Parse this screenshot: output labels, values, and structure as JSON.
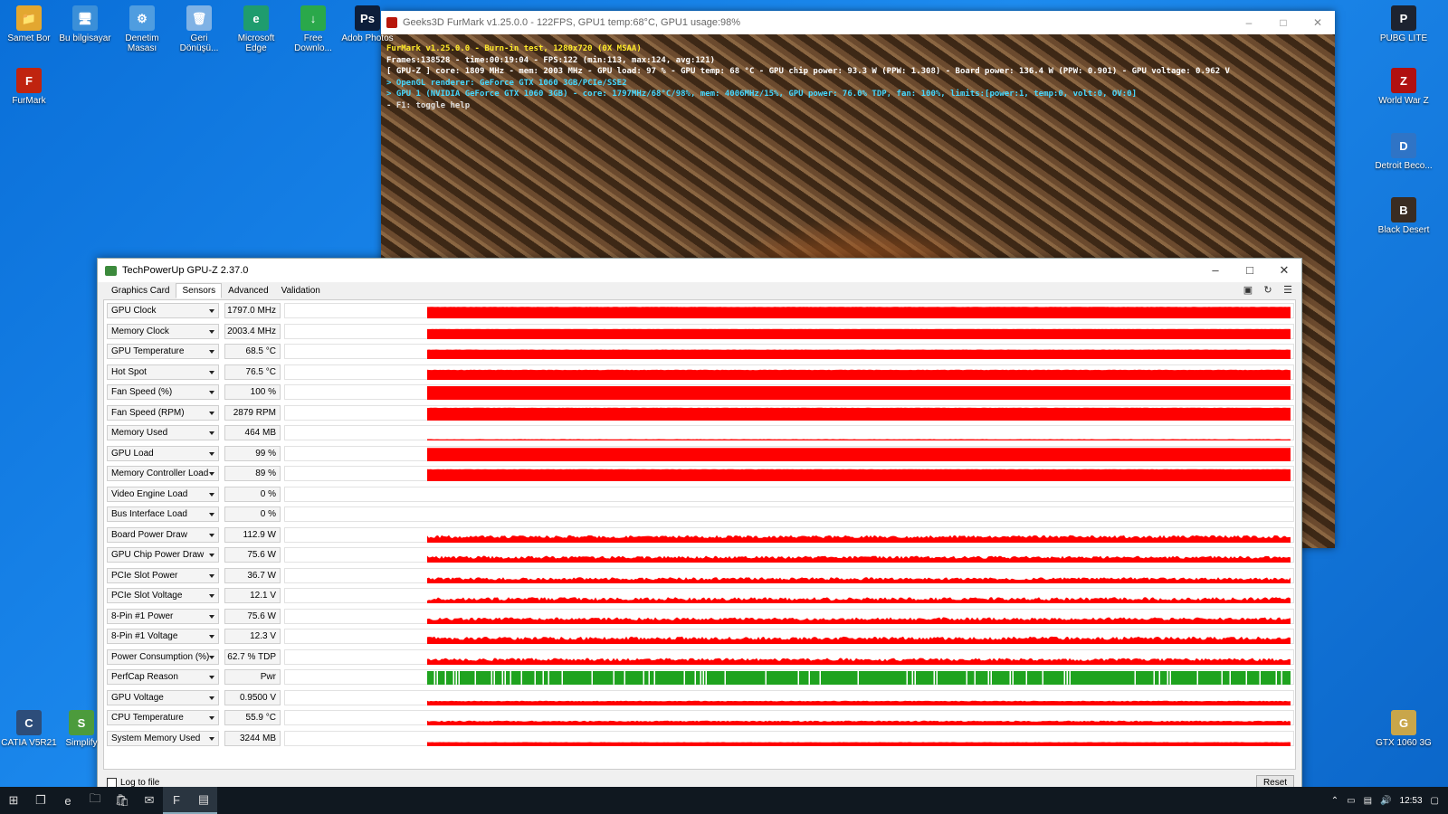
{
  "desktop": {
    "left_icons": [
      {
        "label": "Samet Bor",
        "glyph": "📁",
        "color": "#e3a730"
      },
      {
        "label": "Bu bilgisayar",
        "glyph": "🖥",
        "color": "#3b8fd8"
      },
      {
        "label": "Denetim Masası",
        "glyph": "⚙",
        "color": "#4f9de0"
      },
      {
        "label": "Geri Dönüşü...",
        "glyph": "🗑",
        "color": "#7fb2e5"
      },
      {
        "label": "Microsoft Edge",
        "glyph": "e",
        "color": "#1f9c6e"
      },
      {
        "label": "Free Downlo...",
        "glyph": "↓",
        "color": "#2aa84a"
      },
      {
        "label": "Adob Photos",
        "glyph": "Ps",
        "color": "#0d1e3a"
      }
    ],
    "furmark_icon": {
      "label": "FurMark",
      "glyph": "F",
      "color": "#c0240f"
    },
    "bottom_left_icons": [
      {
        "label": "CATIA V5R21",
        "glyph": "C",
        "color": "#2d4d7a"
      },
      {
        "label": "Simplify",
        "glyph": "S",
        "color": "#4c9b3c"
      }
    ],
    "right_icons": [
      {
        "label": "PUBG LITE",
        "glyph": "P",
        "color": "#1d2330"
      },
      {
        "label": "World War Z",
        "glyph": "Z",
        "color": "#b01010"
      },
      {
        "label": "Detroit Beco...",
        "glyph": "D",
        "color": "#2f74c6"
      },
      {
        "label": "Black Desert",
        "glyph": "B",
        "color": "#3a2c22"
      },
      {
        "label": "GTX 1060 3G",
        "glyph": "G",
        "color": "#c9a64a"
      }
    ]
  },
  "furmark": {
    "title": "Geeks3D FurMark v1.25.0.0 - 122FPS, GPU1 temp:68°C, GPU1 usage:98%",
    "overlay": [
      {
        "text": "FurMark v1.25.0.0 - Burn-in test, 1280x720 (0X MSAA)",
        "cls": "fm-y"
      },
      {
        "text": "Frames:138528 - time:00:19:04 - FPS:122 (min:113, max:124, avg:121)",
        "cls": "fm-w"
      },
      {
        "text": "[ GPU-Z ] core: 1809 MHz - mem: 2003 MHz - GPU load: 97 % - GPU temp: 68 °C - GPU chip power: 93.3 W (PPW: 1.308) - Board power: 136.4 W (PPW: 0.901) - GPU voltage: 0.962 V",
        "cls": "fm-w"
      },
      {
        "text": "> OpenGL renderer: GeForce GTX 1060 3GB/PCIe/SSE2",
        "cls": "fm-c"
      },
      {
        "text": "> GPU 1 (NVIDIA GeForce GTX 1060 3GB) - core: 1797MHz/68°C/98%, mem: 4006MHz/15%, GPU power: 76.0% TDP, fan: 100%, limits:[power:1, temp:0, volt:0, OV:0]",
        "cls": "fm-c"
      },
      {
        "text": "- F1: toggle help",
        "cls": "fm-g"
      }
    ]
  },
  "gpuz": {
    "title": "TechPowerUp GPU-Z 2.37.0",
    "tabs": [
      "Graphics Card",
      "Sensors",
      "Advanced",
      "Validation"
    ],
    "active_tab": "Sensors",
    "graph_color": "#ff0000",
    "perfcap_color": "#1fa31f",
    "sensors": [
      {
        "name": "GPU Clock",
        "value": "1797.0 MHz",
        "level": 0.85,
        "noise": 0.02
      },
      {
        "name": "Memory Clock",
        "value": "2003.4 MHz",
        "level": 0.75,
        "noise": 0.01
      },
      {
        "name": "GPU Temperature",
        "value": "68.5 °C",
        "level": 0.7,
        "noise": 0.02
      },
      {
        "name": "Hot Spot",
        "value": "76.5 °C",
        "level": 0.75,
        "noise": 0.03
      },
      {
        "name": "Fan Speed (%)",
        "value": "100 %",
        "level": 1.0,
        "noise": 0.0
      },
      {
        "name": "Fan Speed (RPM)",
        "value": "2879 RPM",
        "level": 0.95,
        "noise": 0.02
      },
      {
        "name": "Memory Used",
        "value": "464 MB",
        "level": 0.1,
        "noise": 0.02
      },
      {
        "name": "GPU Load",
        "value": "99 %",
        "level": 0.99,
        "noise": 0.01
      },
      {
        "name": "Memory Controller Load",
        "value": "89 %",
        "level": 0.89,
        "noise": 0.03
      },
      {
        "name": "Video Engine Load",
        "value": "0 %",
        "level": 0.0,
        "noise": 0.0
      },
      {
        "name": "Bus Interface Load",
        "value": "0 %",
        "level": 0.0,
        "noise": 0.0
      },
      {
        "name": "Board Power Draw",
        "value": "112.9 W",
        "level": 0.55,
        "noise": 0.22
      },
      {
        "name": "GPU Chip Power Draw",
        "value": "75.6 W",
        "level": 0.5,
        "noise": 0.22
      },
      {
        "name": "PCIe Slot Power",
        "value": "36.7 W",
        "level": 0.45,
        "noise": 0.2
      },
      {
        "name": "PCIe Slot Voltage",
        "value": "12.1 V",
        "level": 0.45,
        "noise": 0.25
      },
      {
        "name": "8-Pin #1 Power",
        "value": "75.6 W",
        "level": 0.5,
        "noise": 0.22
      },
      {
        "name": "8-Pin #1 Voltage",
        "value": "12.3 V",
        "level": 0.55,
        "noise": 0.25
      },
      {
        "name": "Power Consumption (%)",
        "value": "62.7 % TDP",
        "level": 0.5,
        "noise": 0.22
      },
      {
        "name": "PerfCap Reason",
        "value": "Pwr",
        "level": 1.0,
        "noise": 0.0,
        "perfcap": true
      },
      {
        "name": "GPU Voltage",
        "value": "0.9500 V",
        "level": 0.35,
        "noise": 0.05
      },
      {
        "name": "CPU Temperature",
        "value": "55.9 °C",
        "level": 0.35,
        "noise": 0.08
      },
      {
        "name": "System Memory Used",
        "value": "3244 MB",
        "level": 0.3,
        "noise": 0.02
      }
    ],
    "log_to_file_label": "Log to file",
    "reset_label": "Reset"
  },
  "taskbar": {
    "clock": "12:53",
    "apps": [
      "windows-start-icon",
      "task-view-icon",
      "edge-icon",
      "file-explorer-icon",
      "store-icon",
      "mail-icon",
      "furmark-taskbar-icon",
      "gpuz-taskbar-icon"
    ]
  }
}
